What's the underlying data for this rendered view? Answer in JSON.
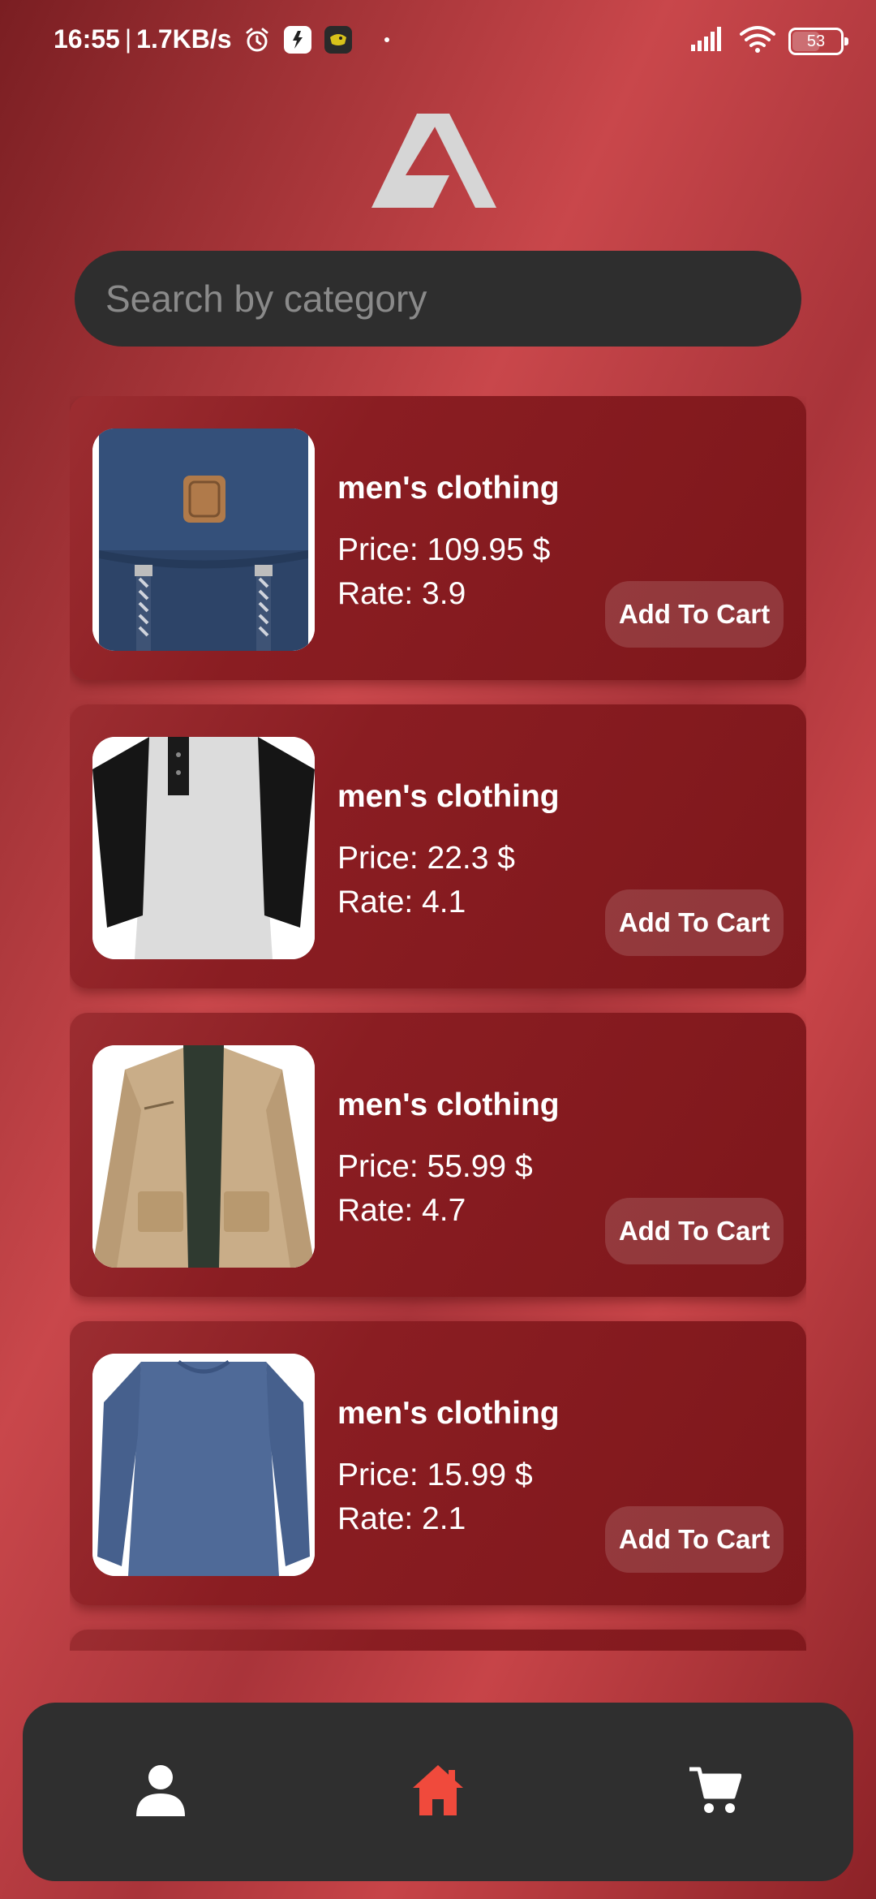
{
  "status_bar": {
    "time": "16:55",
    "separator": "|",
    "speed": "1.7KB/s",
    "battery": "53"
  },
  "search": {
    "placeholder": "Search by category"
  },
  "products": [
    {
      "category": "men's clothing",
      "price": "Price: 109.95 $",
      "rate": "Rate: 3.9",
      "button": "Add To Cart",
      "image": "backpack"
    },
    {
      "category": "men's clothing",
      "price": "Price: 22.3 $",
      "rate": "Rate: 4.1",
      "button": "Add To Cart",
      "image": "raglan-henley-shirt"
    },
    {
      "category": "men's clothing",
      "price": "Price: 55.99 $",
      "rate": "Rate: 4.7",
      "button": "Add To Cart",
      "image": "khaki-jacket"
    },
    {
      "category": "men's clothing",
      "price": "Price: 15.99 $",
      "rate": "Rate: 2.1",
      "button": "Add To Cart",
      "image": "blue-longsleeve-shirt"
    }
  ],
  "nav": {
    "items": [
      "profile",
      "home",
      "cart"
    ],
    "active": "home",
    "active_color": "#f04a3c"
  }
}
